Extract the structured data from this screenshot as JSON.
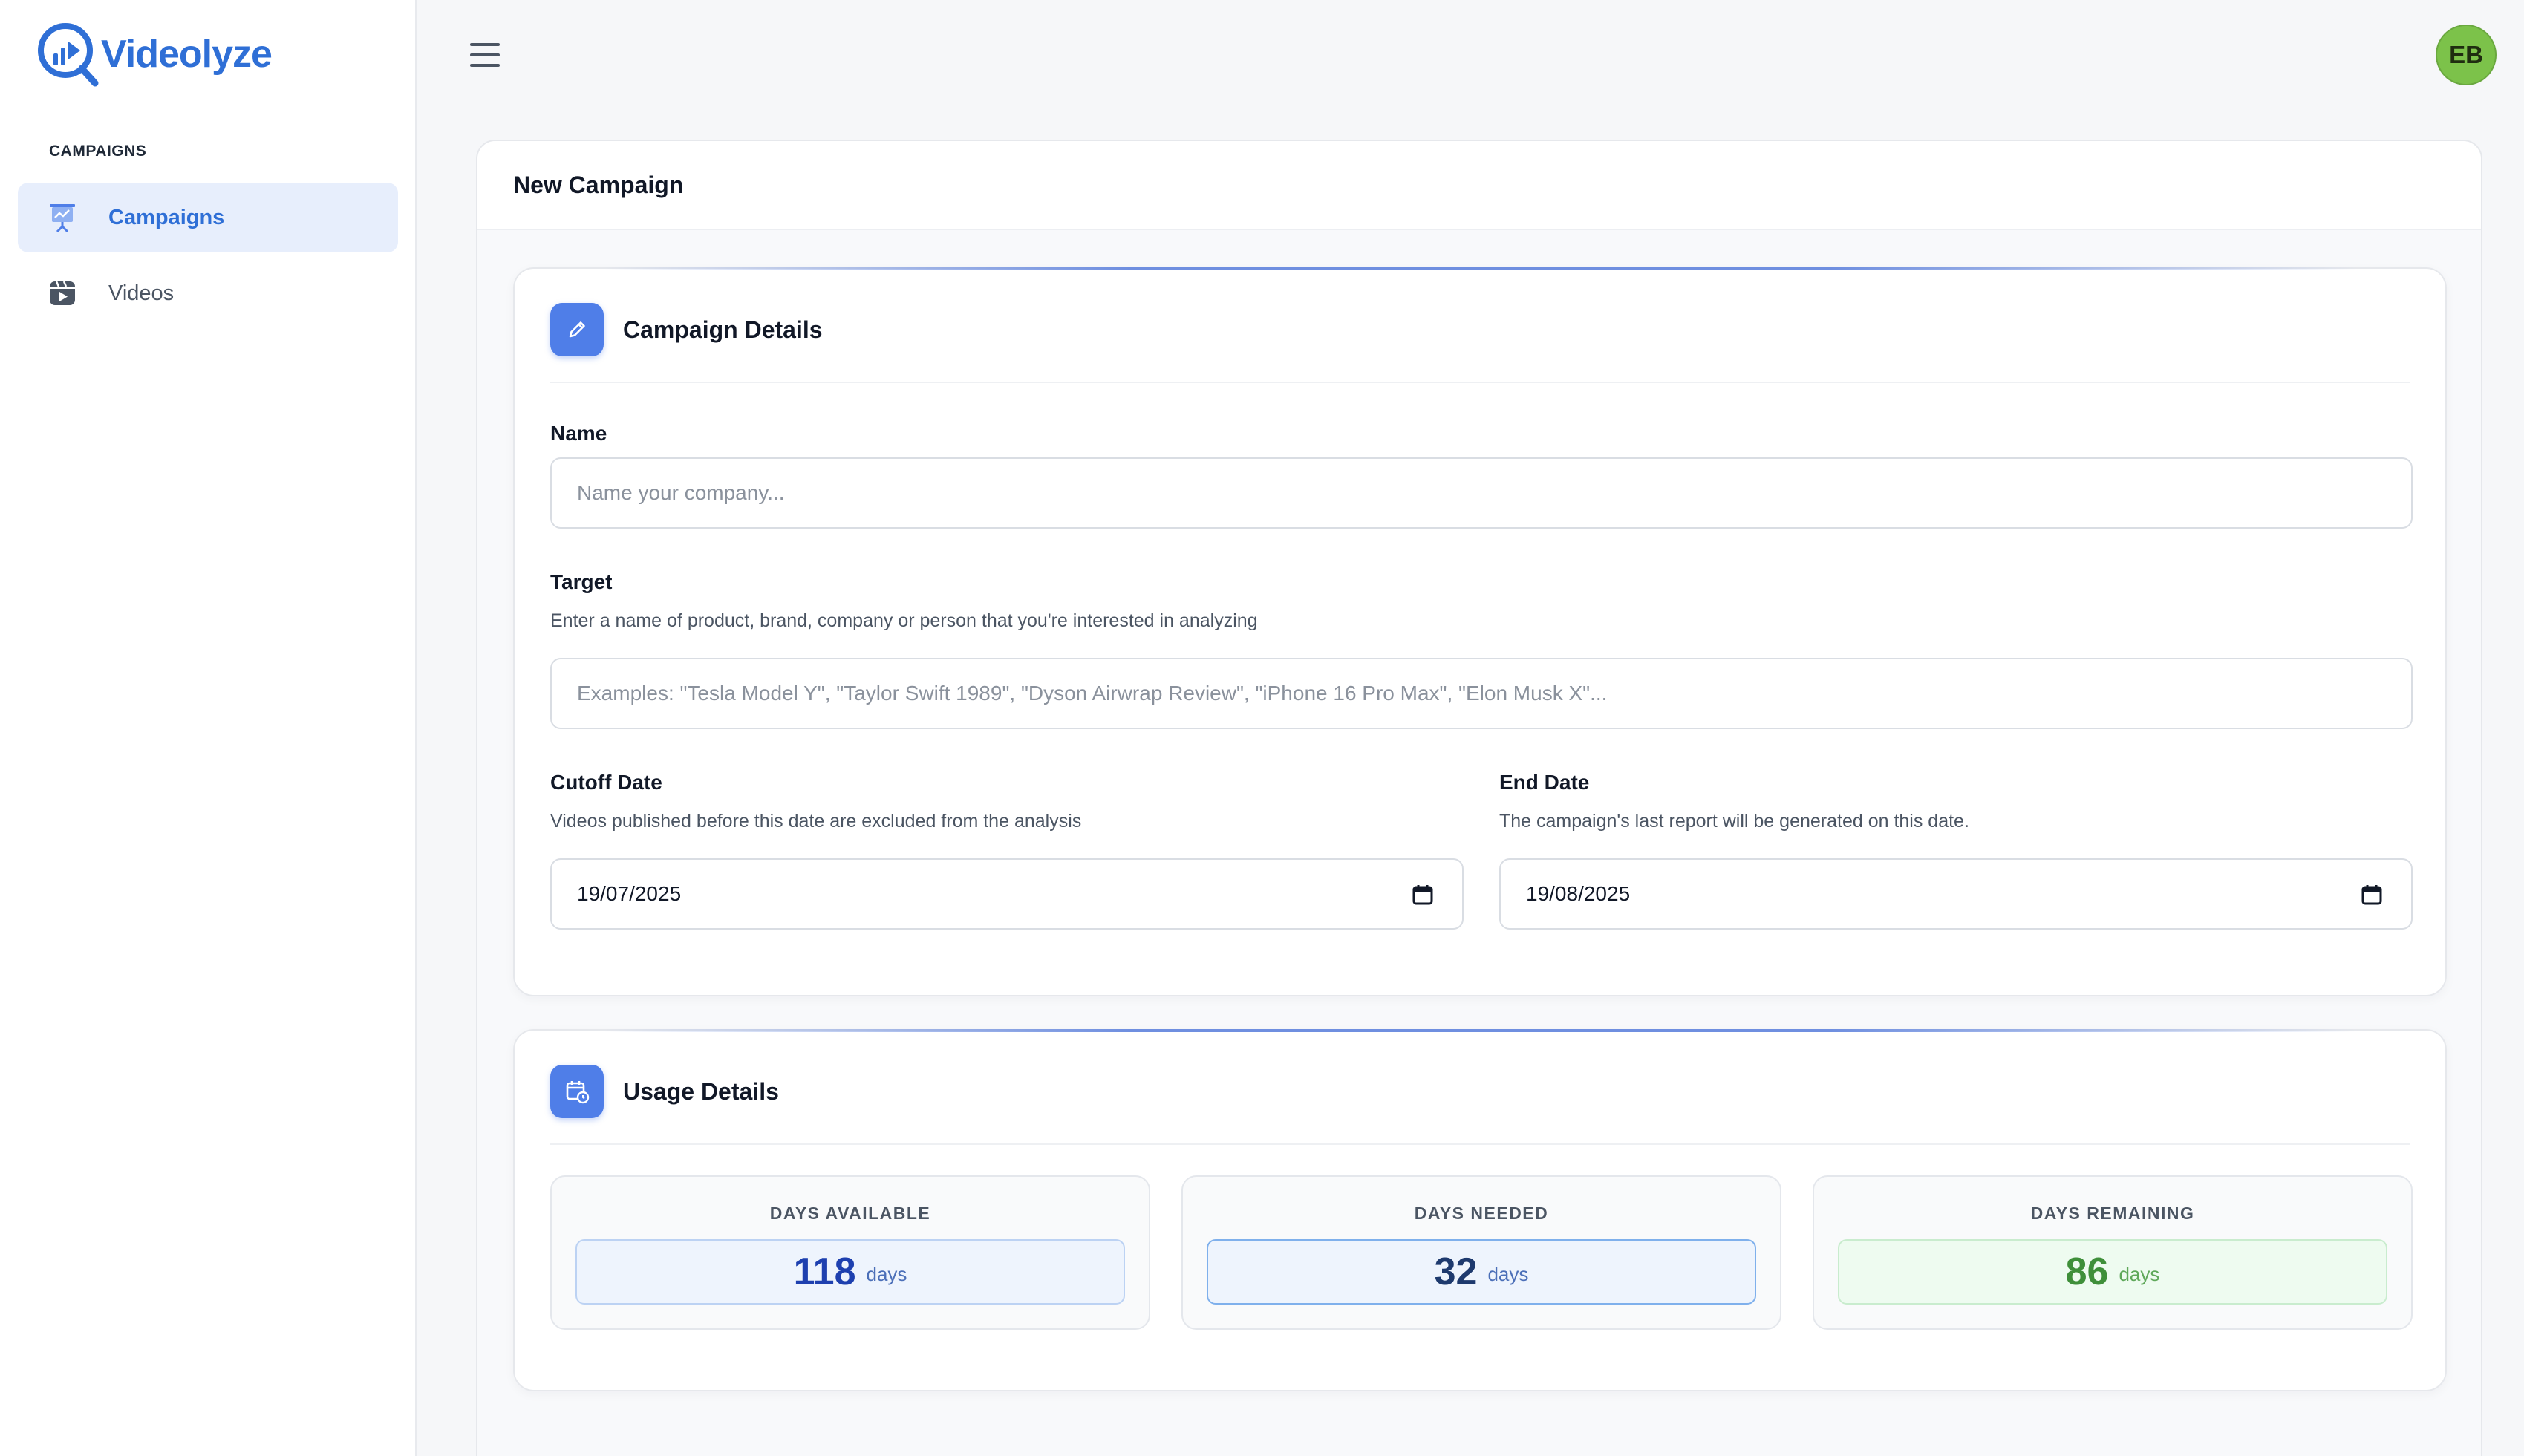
{
  "app": {
    "name": "Videolyze",
    "user_initials": "EB",
    "accent_color": "#2f6fd6"
  },
  "sidebar": {
    "section_label": "CAMPAIGNS",
    "items": [
      {
        "label": "Campaigns",
        "icon": "presentation-chart-icon",
        "active": true
      },
      {
        "label": "Videos",
        "icon": "video-library-icon",
        "active": false
      }
    ]
  },
  "page": {
    "title": "New Campaign"
  },
  "campaign_details": {
    "title": "Campaign Details",
    "icon": "pencil-icon",
    "name": {
      "label": "Name",
      "value": "",
      "placeholder": "Name your company..."
    },
    "target": {
      "label": "Target",
      "help": "Enter a name of product, brand, company or person that you're interested in analyzing",
      "value": "",
      "placeholder": "Examples: \"Tesla Model Y\", \"Taylor Swift 1989\", \"Dyson Airwrap Review\", \"iPhone 16 Pro Max\", \"Elon Musk X\"..."
    },
    "cutoff_date": {
      "label": "Cutoff Date",
      "help": "Videos published before this date are excluded from the analysis",
      "value": "19/07/2025"
    },
    "end_date": {
      "label": "End Date",
      "help": "The campaign's last report will be generated on this date.",
      "value": "19/08/2025"
    }
  },
  "usage_details": {
    "title": "Usage Details",
    "icon": "calendar-clock-icon",
    "stats": [
      {
        "label": "DAYS AVAILABLE",
        "value": "118",
        "unit": "days",
        "color": "#1e40af"
      },
      {
        "label": "DAYS NEEDED",
        "value": "32",
        "unit": "days",
        "color": "#1e3a6e"
      },
      {
        "label": "DAYS REMAINING",
        "value": "86",
        "unit": "days",
        "color": "#3f8f3a"
      }
    ]
  }
}
